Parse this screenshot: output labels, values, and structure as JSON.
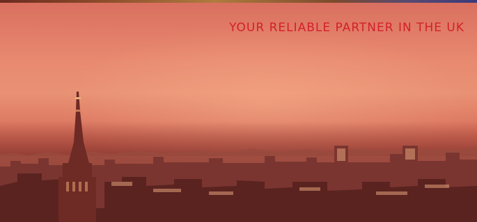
{
  "banner": {
    "tagline": "YOUR RELIABLE PARTNER IN THE UK"
  },
  "colors": {
    "tagline": "#d3202a",
    "sky_top": "#d96f5f",
    "sky_mid": "#e99174",
    "city_dark": "#4e1c1a"
  },
  "scene": {
    "description_icon": "london-skyline-photo"
  }
}
